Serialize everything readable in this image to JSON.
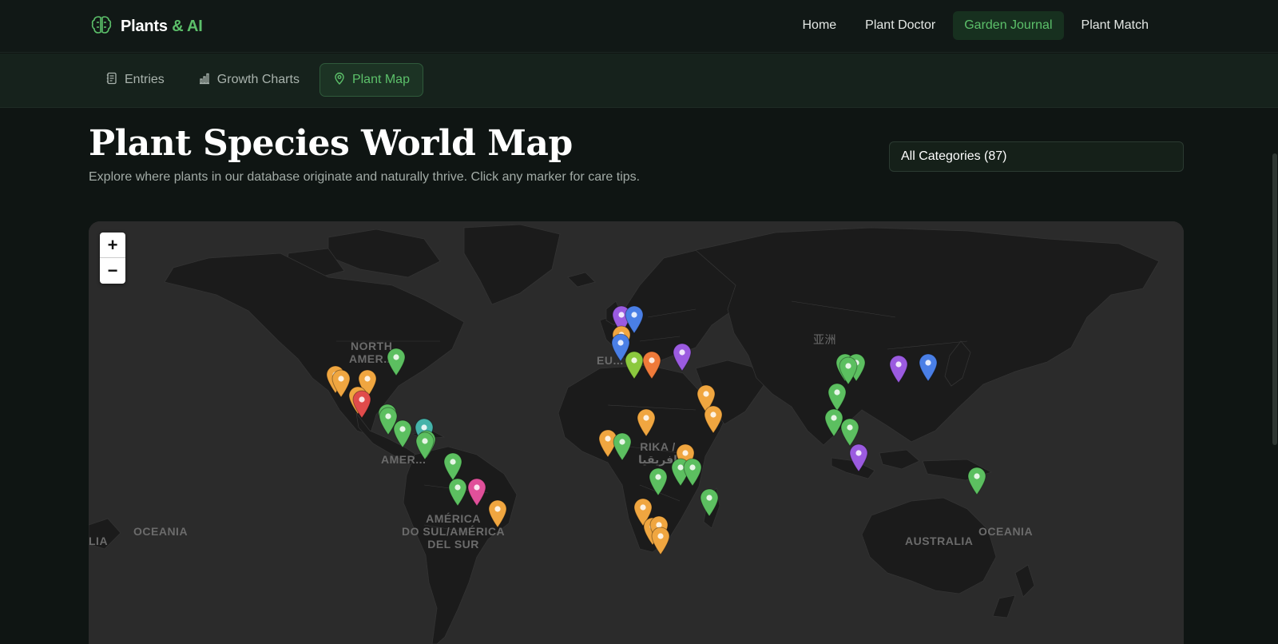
{
  "brand": {
    "name_main": "Plants",
    "name_accent": "& AI",
    "logo_icon": "brain-icon"
  },
  "nav": {
    "items": [
      {
        "label": "Home",
        "active": false
      },
      {
        "label": "Plant Doctor",
        "active": false
      },
      {
        "label": "Garden Journal",
        "active": true
      },
      {
        "label": "Plant Match",
        "active": false
      }
    ]
  },
  "subnav": {
    "tabs": [
      {
        "label": "Entries",
        "icon": "journal-icon",
        "active": false
      },
      {
        "label": "Growth Charts",
        "icon": "bar-chart-icon",
        "active": false
      },
      {
        "label": "Plant Map",
        "icon": "map-pin-icon",
        "active": true
      }
    ]
  },
  "page": {
    "title": "Plant Species World Map",
    "subtitle": "Explore where plants in our database originate and naturally thrive. Click any marker for care tips."
  },
  "filter": {
    "selected": "All Categories (87)"
  },
  "map": {
    "zoom_in": "+",
    "zoom_out": "−",
    "labels": {
      "north_america": "NORTH\nAMER...",
      "south_america": "AMÉRICA\nDO SUL/AMÉRICA\nDEL SUR",
      "central_america": "AMER...",
      "europe": "EU...",
      "africa": "RIKA /\nافريقيا",
      "asia": "亚洲",
      "australia": "AUSTRALIA",
      "oceania_left": "OCEANIA",
      "oceania_right": "OCEANIA",
      "left_edge": "LIA"
    },
    "colors": {
      "green": "#5cbf60",
      "orange": "#f0a640",
      "purple": "#9b5be0",
      "blue": "#4a7fe6",
      "red": "#e04b4b",
      "teal": "#45b3aa",
      "pink": "#e0509a",
      "lime": "#8bc83e",
      "deep_orange": "#ef7a3a"
    }
  }
}
